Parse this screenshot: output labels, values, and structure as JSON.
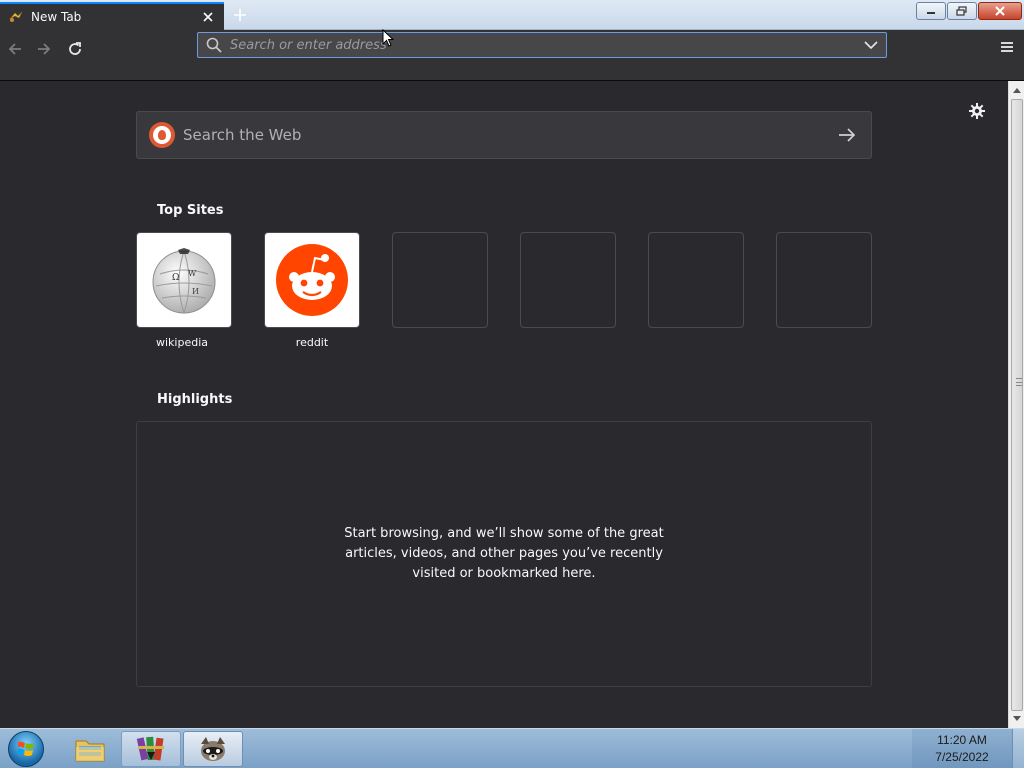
{
  "browser": {
    "tab": {
      "title": "New Tab"
    },
    "urlbar": {
      "placeholder": "Search or enter address"
    }
  },
  "newtab": {
    "search": {
      "placeholder": "Search the Web"
    },
    "top_sites": {
      "heading": "Top Sites",
      "items": [
        {
          "label": "wikipedia",
          "icon": "wikipedia-globe-icon"
        },
        {
          "label": "reddit",
          "icon": "reddit-alien-icon"
        },
        {
          "label": "",
          "icon": ""
        },
        {
          "label": "",
          "icon": ""
        },
        {
          "label": "",
          "icon": ""
        },
        {
          "label": "",
          "icon": ""
        }
      ]
    },
    "highlights": {
      "heading": "Highlights",
      "empty_message": "Start browsing, and we’ll show some of the great articles, videos, and other pages you’ve recently visited or bookmarked here."
    }
  },
  "taskbar": {
    "items": [
      "start-orb-icon",
      "file-explorer-icon",
      "winrar-icon",
      "browser-icon"
    ],
    "clock": {
      "time": "11:20 AM",
      "date": "7/25/2022"
    }
  },
  "colors": {
    "content_bg": "#2a2a2e",
    "toolbar_bg": "#323234",
    "accent": "#0a84ff",
    "reddit": "#ff4500",
    "duckduckgo": "#de5833"
  }
}
